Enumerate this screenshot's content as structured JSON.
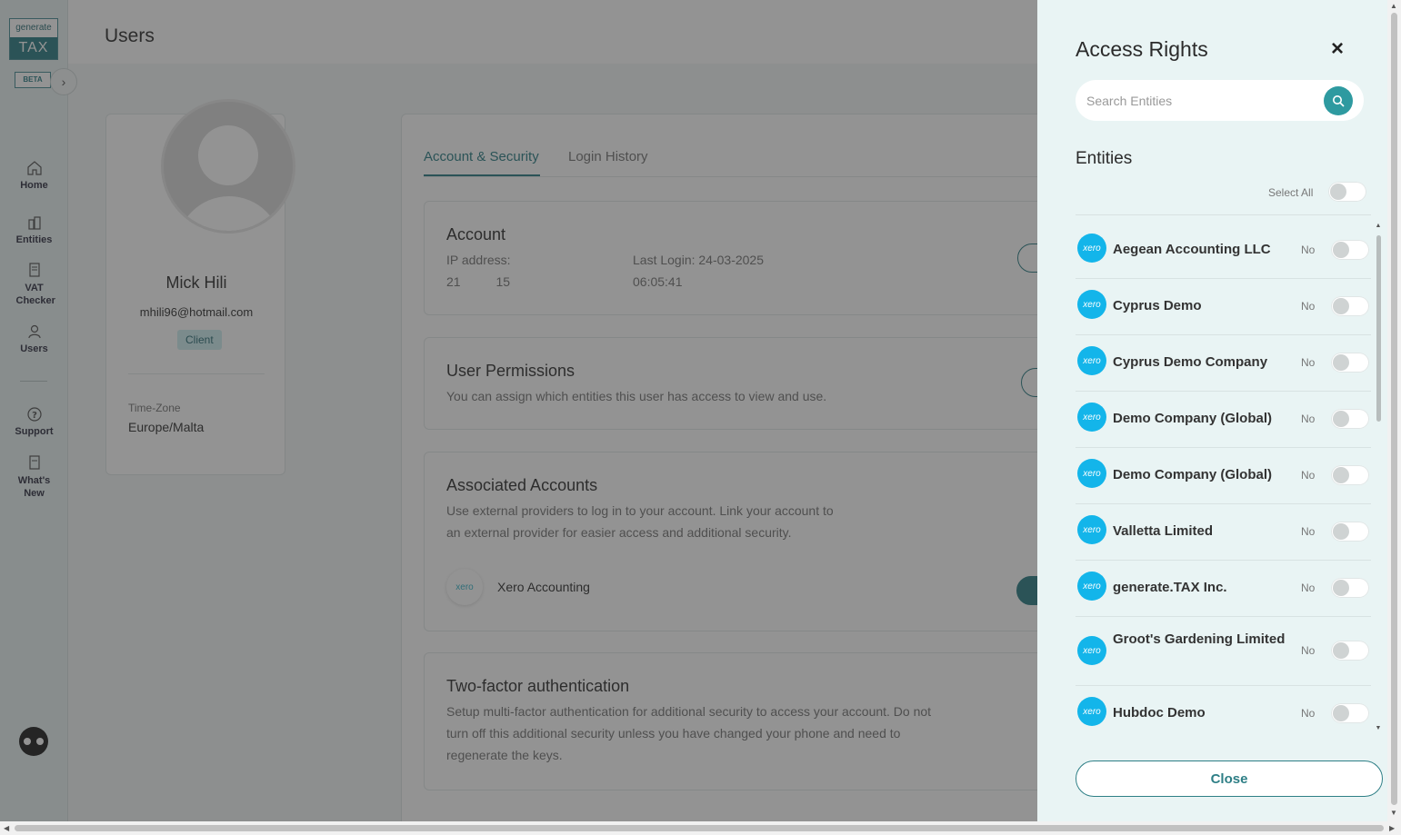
{
  "sidebar": {
    "logo_top": "generate",
    "logo_bottom": "TAX",
    "beta": "BETA",
    "expand": "›",
    "items": [
      {
        "label": "Home",
        "icon": "home-icon"
      },
      {
        "label": "Entities",
        "icon": "building-icon"
      },
      {
        "label": "VAT Checker",
        "icon": "document-icon"
      },
      {
        "label": "Users",
        "icon": "user-icon"
      },
      {
        "label": "Support",
        "icon": "help-icon"
      },
      {
        "label": "What's New",
        "icon": "news-icon"
      }
    ]
  },
  "header": {
    "title": "Users"
  },
  "profile": {
    "name": "Mick Hili",
    "email": "mhili96@hotmail.com",
    "role": "Client",
    "timezone_label": "Time-Zone",
    "timezone_value": "Europe/Malta"
  },
  "tabs": [
    {
      "label": "Account & Security",
      "active": true
    },
    {
      "label": "Login History",
      "active": false
    }
  ],
  "account": {
    "title": "Account",
    "ip_label": "IP address:",
    "ip_value": "21          15",
    "last_login_label": "Last Login: 24-03-2025",
    "last_login_time": "06:05:41"
  },
  "permissions": {
    "title": "User Permissions",
    "description": "You can assign which entities this user has access to view and use."
  },
  "associated": {
    "title": "Associated Accounts",
    "description_1": "Use external providers to log in to your account. Link your account to",
    "description_2": "an external provider for easier access and additional security.",
    "provider": "Xero Accounting",
    "provider_logo": "xero"
  },
  "twofa": {
    "title": "Two-factor authentication",
    "description_1": "Setup multi-factor authentication for additional security to access your account. Do not",
    "description_2": "turn off this additional security unless you have changed your phone and need to",
    "description_3": "regenerate the keys."
  },
  "drawer": {
    "title": "Access Rights",
    "close_icon": "×",
    "search_placeholder": "Search Entities",
    "entities_title": "Entities",
    "select_all": "Select All",
    "xero_label": "xero",
    "close_button": "Close",
    "entities": [
      {
        "name": "Aegean Accounting LLC",
        "status": "No"
      },
      {
        "name": "Cyprus Demo",
        "status": "No"
      },
      {
        "name": "Cyprus Demo Company",
        "status": "No"
      },
      {
        "name": "Demo Company (Global)",
        "status": "No"
      },
      {
        "name": "Demo Company (Global)",
        "status": "No"
      },
      {
        "name": "Valletta Limited",
        "status": "No"
      },
      {
        "name": "generate.TAX Inc.",
        "status": "No"
      },
      {
        "name": "Groot's Gardening Limited",
        "status": "No"
      },
      {
        "name": "Hubdoc Demo",
        "status": "No"
      }
    ]
  },
  "colors": {
    "accent": "#2e7f86",
    "xero": "#13b5ea",
    "drawer_bg": "#e9f4f4"
  }
}
